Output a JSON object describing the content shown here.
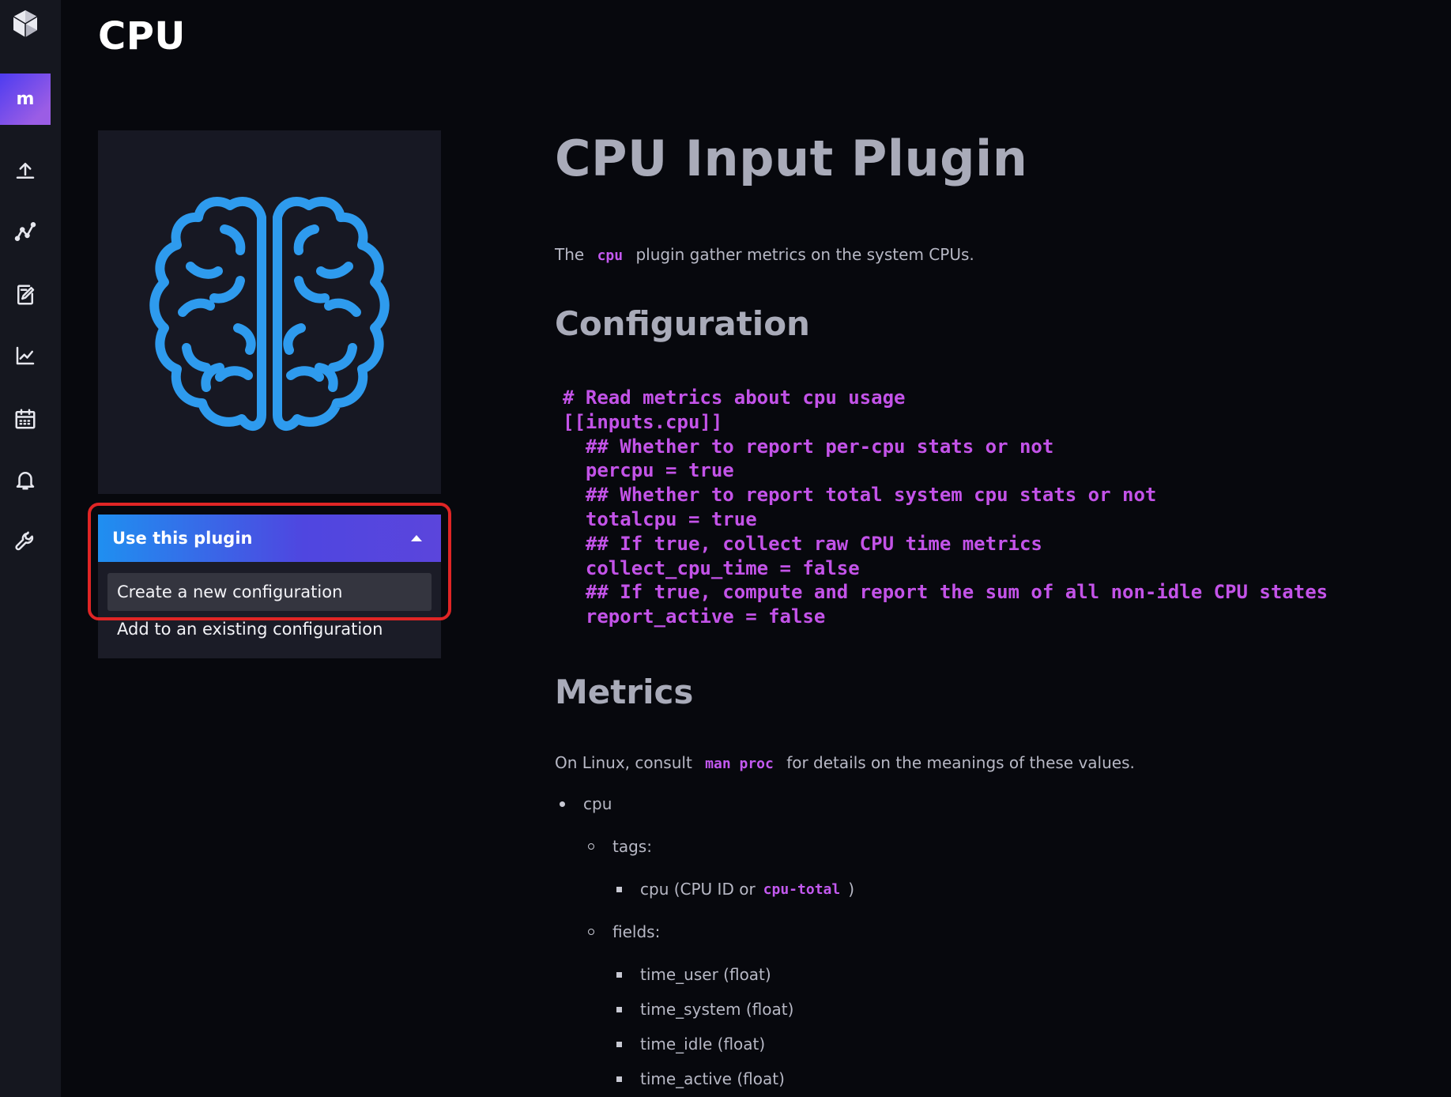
{
  "sidebar": {
    "org_initial": "m",
    "icons": [
      "upload-icon",
      "data-explorer-icon",
      "notebook-icon",
      "dashboard-chart-icon",
      "tasks-calendar-icon",
      "alerts-bell-icon",
      "settings-wrench-icon"
    ]
  },
  "header": {
    "title": "CPU"
  },
  "plugin_card": {
    "logo_icon": "brain-icon",
    "logo_color": "#2e9bee",
    "use_button_label": "Use this plugin",
    "menu": {
      "create_new": "Create a new configuration",
      "add_existing": "Add to an existing configuration"
    }
  },
  "doc": {
    "title": "CPU Input Plugin",
    "intro_before": "The",
    "intro_code": "cpu",
    "intro_after": "plugin gather metrics on the system CPUs.",
    "configuration_heading": "Configuration",
    "config_code": [
      "# Read metrics about cpu usage",
      "[[inputs.cpu]]",
      "  ## Whether to report per-cpu stats or not",
      "  percpu = true",
      "  ## Whether to report total system cpu stats or not",
      "  totalcpu = true",
      "  ## If true, collect raw CPU time metrics",
      "  collect_cpu_time = false",
      "  ## If true, compute and report the sum of all non-idle CPU states",
      "  report_active = false"
    ],
    "metrics_heading": "Metrics",
    "metrics_before": "On Linux, consult",
    "metrics_code": "man proc",
    "metrics_after": "for details on the meanings of these values.",
    "measurement": "cpu",
    "tags_label": "tags:",
    "tag_item_before": "cpu (CPU ID or",
    "tag_item_code": "cpu-total",
    "tag_item_after": ")",
    "fields_label": "fields:",
    "fields": [
      "time_user (float)",
      "time_system (float)",
      "time_idle (float)",
      "time_active (float)"
    ]
  },
  "colors": {
    "accent_gradient_start": "#1f8ff0",
    "accent_gradient_end": "#5b45dc",
    "code_color": "#c353e8",
    "highlight_border": "#e02525"
  }
}
